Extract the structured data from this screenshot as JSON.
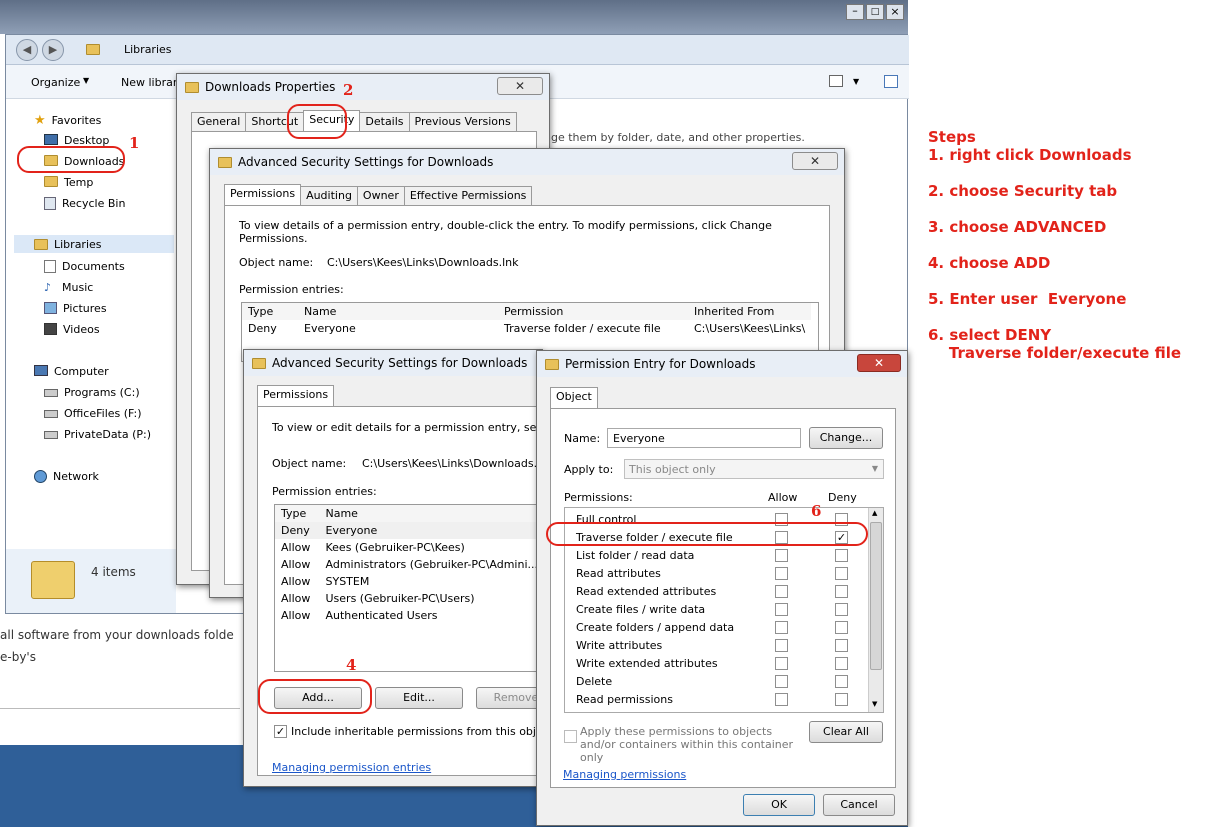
{
  "explorer": {
    "address": "Libraries",
    "toolbar": {
      "organize": "Organize",
      "new_library": "New librar"
    },
    "status": "4 items",
    "nav": {
      "favorites": "Favorites",
      "fav_items": [
        "Desktop",
        "Downloads",
        "Temp",
        "Recycle Bin"
      ],
      "libraries": "Libraries",
      "lib_items": [
        "Documents",
        "Music",
        "Pictures",
        "Videos"
      ],
      "computer": "Computer",
      "comp_items": [
        "Programs (C:)",
        "OfficeFiles  (F:)",
        "PrivateData (P:)"
      ],
      "network": "Network"
    },
    "hint": "ge them by folder, date, and other properties.",
    "bg_text_1": "all software from your downloads folde",
    "bg_text_2": "e-by's"
  },
  "props": {
    "title": "Downloads Properties",
    "tabs": [
      "General",
      "Shortcut",
      "Security",
      "Details",
      "Previous Versions"
    ]
  },
  "adv1": {
    "title": "Advanced Security Settings for Downloads",
    "tabs": [
      "Permissions",
      "Auditing",
      "Owner",
      "Effective Permissions"
    ],
    "info": "To view details of a permission entry, double-click the entry. To modify permissions, click Change Permissions.",
    "object_label": "Object name:",
    "object_value": "C:\\Users\\Kees\\Links\\Downloads.lnk",
    "entries_label": "Permission entries:",
    "columns": [
      "Type",
      "Name",
      "Permission",
      "Inherited From"
    ],
    "rows": [
      [
        "Deny",
        "Everyone",
        "Traverse folder / execute file",
        "C:\\Users\\Kees\\Links\\"
      ]
    ]
  },
  "adv2": {
    "title": "Advanced Security Settings for Downloads",
    "tab": "Permissions",
    "info": "To view or edit details for a permission entry, select the",
    "object_label": "Object name:",
    "object_value": "C:\\Users\\Kees\\Links\\Downloads.lnk",
    "entries_label": "Permission entries:",
    "columns": [
      "Type",
      "Name"
    ],
    "rows": [
      [
        "Deny",
        "Everyone"
      ],
      [
        "Allow",
        "Kees (Gebruiker-PC\\Kees)"
      ],
      [
        "Allow",
        "Administrators (Gebruiker-PC\\Admini..."
      ],
      [
        "Allow",
        "SYSTEM"
      ],
      [
        "Allow",
        "Users (Gebruiker-PC\\Users)"
      ],
      [
        "Allow",
        "Authenticated Users"
      ]
    ],
    "add": "Add...",
    "edit": "Edit...",
    "remove": "Remove",
    "inherit": "Include inheritable permissions from this object's pa",
    "link": "Managing permission entries"
  },
  "perm": {
    "title": "Permission Entry for Downloads",
    "tab": "Object",
    "name_label": "Name:",
    "name_value": "Everyone",
    "change": "Change...",
    "apply_label": "Apply to:",
    "apply_value": "This object only",
    "perms_label": "Permissions:",
    "allow": "Allow",
    "deny": "Deny",
    "items": [
      "Full control",
      "Traverse folder / execute file",
      "List folder / read data",
      "Read attributes",
      "Read extended attributes",
      "Create files / write data",
      "Create folders / append data",
      "Write attributes",
      "Write extended attributes",
      "Delete",
      "Read permissions"
    ],
    "apply_text": "Apply these permissions to objects and/or containers within this container only",
    "clear": "Clear All",
    "link": "Managing permissions",
    "ok": "OK",
    "cancel": "Cancel"
  },
  "annotations": [
    "1",
    "2",
    "4",
    "6"
  ],
  "steps": [
    "Steps",
    "1. right click Downloads",
    "2. choose Security tab",
    "3. choose ADVANCED",
    "4. choose ADD",
    "5. Enter user  Everyone",
    "6. select DENY",
    "    Traverse folder/execute file"
  ]
}
